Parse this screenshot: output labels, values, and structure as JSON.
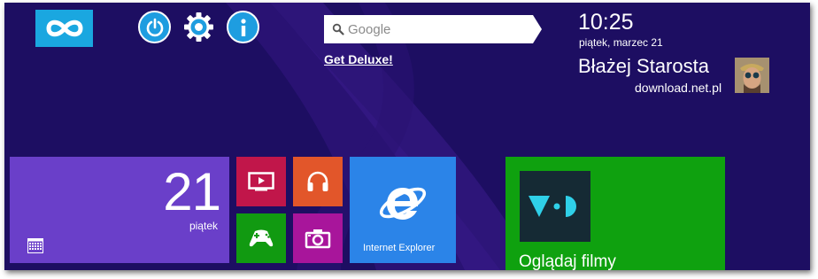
{
  "header": {
    "search": {
      "placeholder": "Google"
    },
    "deluxe_link": "Get Deluxe!",
    "clock": {
      "time": "10:25",
      "date": "piątek, marzec 21"
    },
    "user": {
      "name": "Błażej Starosta",
      "site": "download.net.pl"
    }
  },
  "toolbar": {
    "icons": [
      "infinity-icon",
      "power-icon",
      "settings-gear-icon",
      "info-icon"
    ]
  },
  "tiles": {
    "calendar": {
      "day_number": "21",
      "day_name": "piątek",
      "icon": "calendar-icon"
    },
    "video": {
      "icon": "video-play-icon",
      "color": "#c1164a"
    },
    "music": {
      "icon": "headphones-icon",
      "color": "#e2562a"
    },
    "games": {
      "icon": "gamepad-icon",
      "color": "#119a11"
    },
    "camera": {
      "icon": "camera-icon",
      "color": "#a8159b"
    },
    "ie": {
      "label": "Internet Explorer",
      "icon": "internet-explorer-icon",
      "color": "#2b84e8"
    },
    "vod": {
      "label": "Oglądaj filmy",
      "icon": "vod-logo-icon",
      "color": "#0fa10f"
    }
  },
  "colors": {
    "background": "#1d0e62",
    "calendar_tile": "#6a3fc9",
    "accent_blue": "#1aa7e0"
  }
}
